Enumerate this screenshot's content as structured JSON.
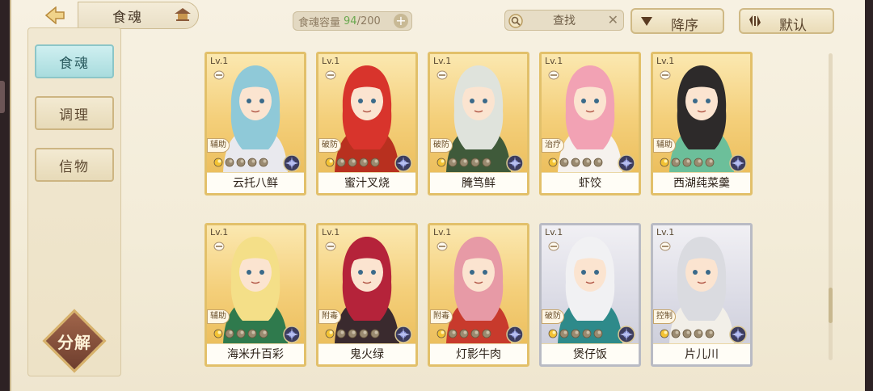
{
  "header": {
    "title": "食魂",
    "capacity_label": "食魂容量",
    "capacity_current": "94",
    "capacity_max": "/200",
    "capacity_plus": "+",
    "search_label": "查找",
    "search_clear": "✕",
    "sort_order": "降序",
    "sort_mode": "默认"
  },
  "sidebar": {
    "tabs": [
      {
        "label": "食魂",
        "active": true
      },
      {
        "label": "调理",
        "active": false
      },
      {
        "label": "信物",
        "active": false
      }
    ],
    "decompose_label": "分解"
  },
  "cards": [
    {
      "level": "Lv.1",
      "role": "辅助",
      "name": "云托八鲜",
      "rarity": "gold",
      "hair": "#8fc9d8",
      "outfit": "#e9e9ee"
    },
    {
      "level": "Lv.1",
      "role": "破防",
      "name": "蜜汁叉烧",
      "rarity": "gold",
      "hair": "#d8342c",
      "outfit": "#b8301f"
    },
    {
      "level": "Lv.1",
      "role": "破防",
      "name": "腌笃鲜",
      "rarity": "gold",
      "hair": "#dfe3dc",
      "outfit": "#3f5a3a"
    },
    {
      "level": "Lv.1",
      "role": "治疗",
      "name": "虾饺",
      "rarity": "gold",
      "hair": "#f2a2b4",
      "outfit": "#f6f2ee"
    },
    {
      "level": "Lv.1",
      "role": "辅助",
      "name": "西湖莼菜羹",
      "rarity": "gold",
      "hair": "#2d2a2a",
      "outfit": "#6cbf9a"
    },
    {
      "level": "Lv.1",
      "role": "辅助",
      "name": "海米升百彩",
      "rarity": "gold",
      "hair": "#f4df88",
      "outfit": "#2f7a4d"
    },
    {
      "level": "Lv.1",
      "role": "附毒",
      "name": "鬼火绿",
      "rarity": "gold",
      "hair": "#b5233a",
      "outfit": "#3a2a2e"
    },
    {
      "level": "Lv.1",
      "role": "附毒",
      "name": "灯影牛肉",
      "rarity": "gold",
      "hair": "#e79aa6",
      "outfit": "#c83a2c"
    },
    {
      "level": "Lv.1",
      "role": "破防",
      "name": "煲仔饭",
      "rarity": "silver",
      "hair": "#f1f1f3",
      "outfit": "#2e8a8a"
    },
    {
      "level": "Lv.1",
      "role": "控制",
      "name": "片儿川",
      "rarity": "silver",
      "hair": "#dadbe0",
      "outfit": "#f2efe8"
    }
  ],
  "colors": {
    "accent_gold": "#e2c06a",
    "accent_teal": "#a9dcde",
    "capacity_green": "#6aa84f"
  },
  "icons": {
    "back": "back-arrow-icon",
    "search": "magnifier-icon",
    "element": "element-orb-icon",
    "star": "star-icon"
  }
}
